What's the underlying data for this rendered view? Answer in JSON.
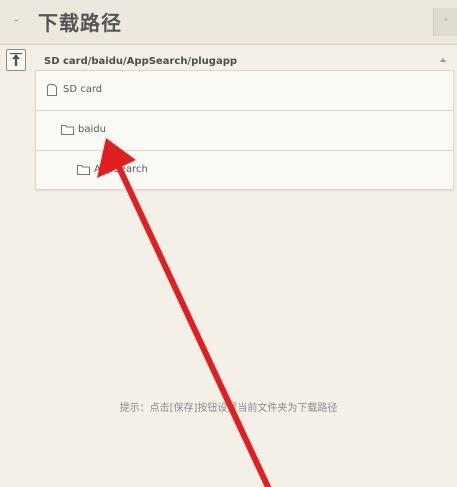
{
  "header": {
    "title": "下载路径",
    "back_glyph": "-",
    "menu_glyph": "·"
  },
  "pathbar": {
    "current_path": "SD card/baidu/AppSearch/plugapp",
    "up_icon": "folder-up-icon",
    "caret_icon": "caret-up-icon"
  },
  "dropdown": {
    "items": [
      {
        "label": "SD card",
        "icon": "sd-card-icon"
      },
      {
        "label": "baidu",
        "icon": "folder-icon"
      },
      {
        "label": "AppSearch",
        "icon": "folder-icon"
      }
    ]
  },
  "hint": {
    "text": "提示：点击[保存]按钮设置当前文件夹为下载路径"
  },
  "annotation": {
    "arrow_color": "#e02020",
    "arrow_icon": "red-arrow-pointer"
  }
}
